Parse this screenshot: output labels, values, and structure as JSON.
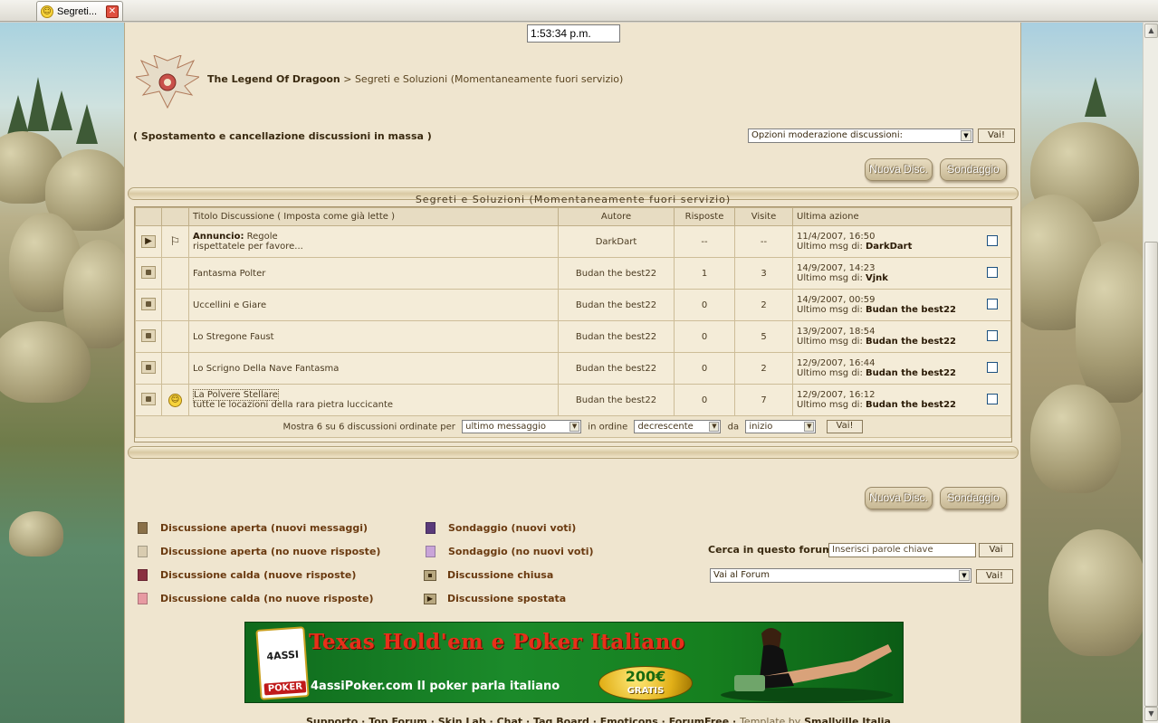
{
  "browser": {
    "tab_title": "Segreti..."
  },
  "clock": "1:53:34 p.m.",
  "breadcrumb": {
    "forum": "The Legend Of Dragoon",
    "separator": ">",
    "section": "Segreti e Soluzioni (Momentaneamente fuori servizio)"
  },
  "mass_moderation": "( Spostamento e cancellazione discussioni in massa )",
  "moderation_select": {
    "value": "Opzioni moderazione discussioni:",
    "go": "Vai!"
  },
  "buttons": {
    "new_topic": "Nuova Disc.",
    "poll": "Sondaggio"
  },
  "table": {
    "title": "Segreti e Soluzioni (Momentaneamente fuori servizio)",
    "headers": {
      "title": "Titolo Discussione",
      "mark_read": "( Imposta come già lette )",
      "author": "Autore",
      "replies": "Risposte",
      "views": "Visite",
      "last_action": "Ultima azione"
    },
    "last_prefix": "Ultimo msg di:",
    "rows": [
      {
        "status": "moved",
        "emoji": "flag",
        "prefix": "Annuncio:",
        "title": "Regole",
        "subtitle": "rispettatele per favore...",
        "author": "DarkDart",
        "replies": "--",
        "views": "--",
        "last_date": "11/4/2007, 16:50",
        "last_user": "DarkDart"
      },
      {
        "status": "locked",
        "emoji": "",
        "prefix": "",
        "title": "Fantasma Polter",
        "subtitle": "",
        "author": "Budan the best22",
        "replies": "1",
        "views": "3",
        "last_date": "14/9/2007, 14:23",
        "last_user": "Vjnk"
      },
      {
        "status": "locked",
        "emoji": "",
        "prefix": "",
        "title": "Uccellini e Giare",
        "subtitle": "",
        "author": "Budan the best22",
        "replies": "0",
        "views": "2",
        "last_date": "14/9/2007, 00:59",
        "last_user": "Budan the best22"
      },
      {
        "status": "locked",
        "emoji": "",
        "prefix": "",
        "title": "Lo Stregone Faust",
        "subtitle": "",
        "author": "Budan the best22",
        "replies": "0",
        "views": "5",
        "last_date": "13/9/2007, 18:54",
        "last_user": "Budan the best22"
      },
      {
        "status": "locked",
        "emoji": "",
        "prefix": "",
        "title": "Lo Scrigno Della Nave Fantasma",
        "subtitle": "",
        "author": "Budan the best22",
        "replies": "0",
        "views": "2",
        "last_date": "12/9/2007, 16:44",
        "last_user": "Budan the best22"
      },
      {
        "status": "locked",
        "emoji": "smile",
        "prefix": "",
        "title": "La Polvere Stellare",
        "subtitle": "tutte le locazioni della rara pietra luccicante",
        "author": "Budan the best22",
        "replies": "0",
        "views": "7",
        "last_date": "12/9/2007, 16:12",
        "last_user": "Budan the best22"
      }
    ],
    "footer": {
      "text_before": "Mostra 6 su 6 discussioni ordinate per",
      "sort_by": "ultimo messaggio",
      "text_order": "in ordine",
      "order": "decrescente",
      "text_from": "da",
      "from": "inizio",
      "go": "Vai!"
    }
  },
  "legend": [
    {
      "label": "Discussione aperta (nuovi messaggi)",
      "color": "#8a7048"
    },
    {
      "label": "Discussione aperta (no nuove risposte)",
      "color": "#d9ccb0"
    },
    {
      "label": "Discussione calda (nuove risposte)",
      "color": "#8a3040"
    },
    {
      "label": "Discussione calda (no nuove risposte)",
      "color": "#e79aa2"
    },
    {
      "label": "Sondaggio (nuovi voti)",
      "color": "#5a3a7a"
    },
    {
      "label": "Sondaggio (no nuovi voti)",
      "color": "#c9a4d8"
    },
    {
      "label": "Discussione chiusa",
      "color": ""
    },
    {
      "label": "Discussione spostata",
      "color": ""
    }
  ],
  "search": {
    "label": "Cerca in questo forum:",
    "placeholder": "Inserisci parole chiave",
    "go": "Vai"
  },
  "jump": {
    "value": "Vai al Forum",
    "go": "Vai!"
  },
  "banner": {
    "headline": "Texas Hold'em e Poker Italiano",
    "tagline": "4assiPoker.com Il poker parla italiano",
    "card_brand": "4ASSI",
    "card_word": "POKER",
    "badge_amount": "200€",
    "badge_word": "GRATIS"
  },
  "bottom_links": {
    "items": [
      "Supporto",
      "Top Forum",
      "Skin Lab",
      "Chat",
      "Tag Board",
      "Emoticons",
      "ForumFree"
    ],
    "separator": "·",
    "template_prefix": "Template by",
    "template_author": "Smallville Italia"
  }
}
